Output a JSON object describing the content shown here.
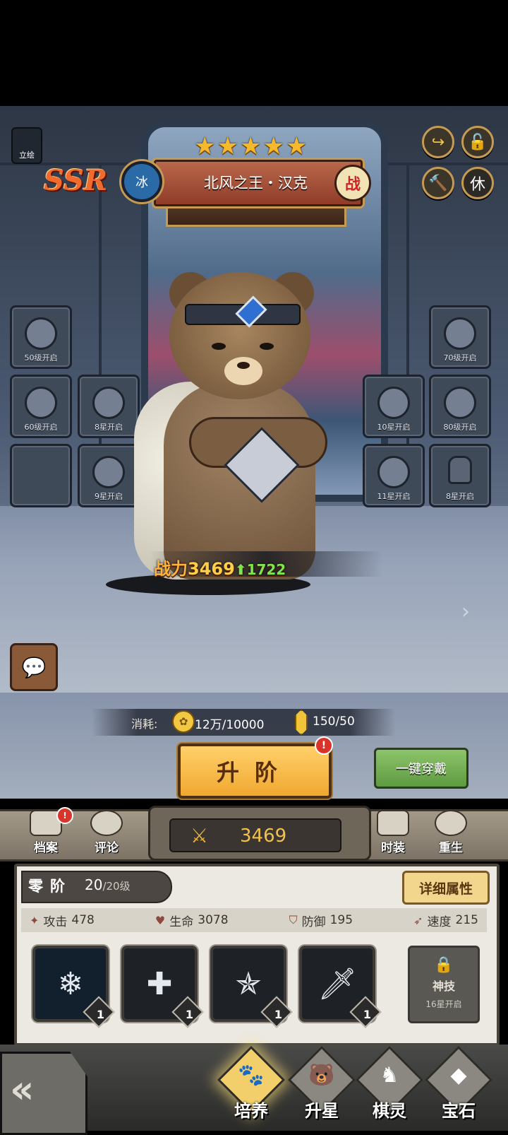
{
  "hero": {
    "rarity": "SSR",
    "stars": [
      "★",
      "★",
      "★",
      "★",
      "★"
    ],
    "element": "冰",
    "name": "北风之王・汉克",
    "role": "战",
    "power_label": "战力",
    "power_value": "3469",
    "power_gain": "1722",
    "power_gain_icon": "⬆"
  },
  "top_buttons": {
    "art_label": "立绘",
    "share_icon": "share-icon",
    "lock_icon": "unlock-icon",
    "hammer_icon": "hammer-icon",
    "rest_label": "休"
  },
  "equipment_slots": [
    {
      "label": "50级开启",
      "icon": "cape-icon"
    },
    {
      "label": "60级开启",
      "icon": "helmet-icon"
    },
    {
      "label": "8星开启",
      "icon": "ring-icon"
    },
    {
      "label": "",
      "icon": "empty-slot"
    },
    {
      "label": "9星开启",
      "icon": "paw-token-icon"
    },
    {
      "label": "70级开启",
      "icon": "armor-icon"
    },
    {
      "label": "10星开启",
      "icon": "necklace-icon"
    },
    {
      "label": "80级开启",
      "icon": "boots-icon"
    },
    {
      "label": "11星开启",
      "icon": "gem-icon"
    },
    {
      "label": "8星开启",
      "icon": "lock-icon"
    }
  ],
  "cost": {
    "label": "消耗:",
    "coin_value": "12万/10000",
    "crystal_value": "150/50"
  },
  "actions": {
    "advance_label": "升阶",
    "advance_alert": "!",
    "equip_all_label": "一键穿戴"
  },
  "toolbar": {
    "archive_label": "档案",
    "archive_alert": "!",
    "comment_label": "评论",
    "total_power": "3469",
    "fashion_label": "时装",
    "rebirth_label": "重生"
  },
  "stage": {
    "name": "零阶",
    "level": "20",
    "max_level": "/20级",
    "detail_label": "详细属性"
  },
  "attributes": [
    {
      "label": "攻击",
      "value": "478",
      "icon": "attack-icon"
    },
    {
      "label": "生命",
      "value": "3078",
      "icon": "heart-icon"
    },
    {
      "label": "防御",
      "value": "195",
      "icon": "shield-icon"
    },
    {
      "label": "速度",
      "value": "215",
      "icon": "speed-icon"
    }
  ],
  "skills": [
    {
      "level": "1",
      "icon": "ice-slash-icon"
    },
    {
      "level": "1",
      "icon": "heal-cross-icon"
    },
    {
      "level": "1",
      "icon": "stars-burst-icon"
    },
    {
      "level": "1",
      "icon": "dagger-strike-icon"
    }
  ],
  "locked_skill": {
    "name": "神技",
    "requirement": "16星开启"
  },
  "bottom_nav": [
    {
      "label": "培养",
      "icon": "paw-icon",
      "active": true
    },
    {
      "label": "升星",
      "icon": "bear-face-icon",
      "active": false
    },
    {
      "label": "棋灵",
      "icon": "chess-icon",
      "active": false
    },
    {
      "label": "宝石",
      "icon": "diamond-icon",
      "active": false
    }
  ]
}
